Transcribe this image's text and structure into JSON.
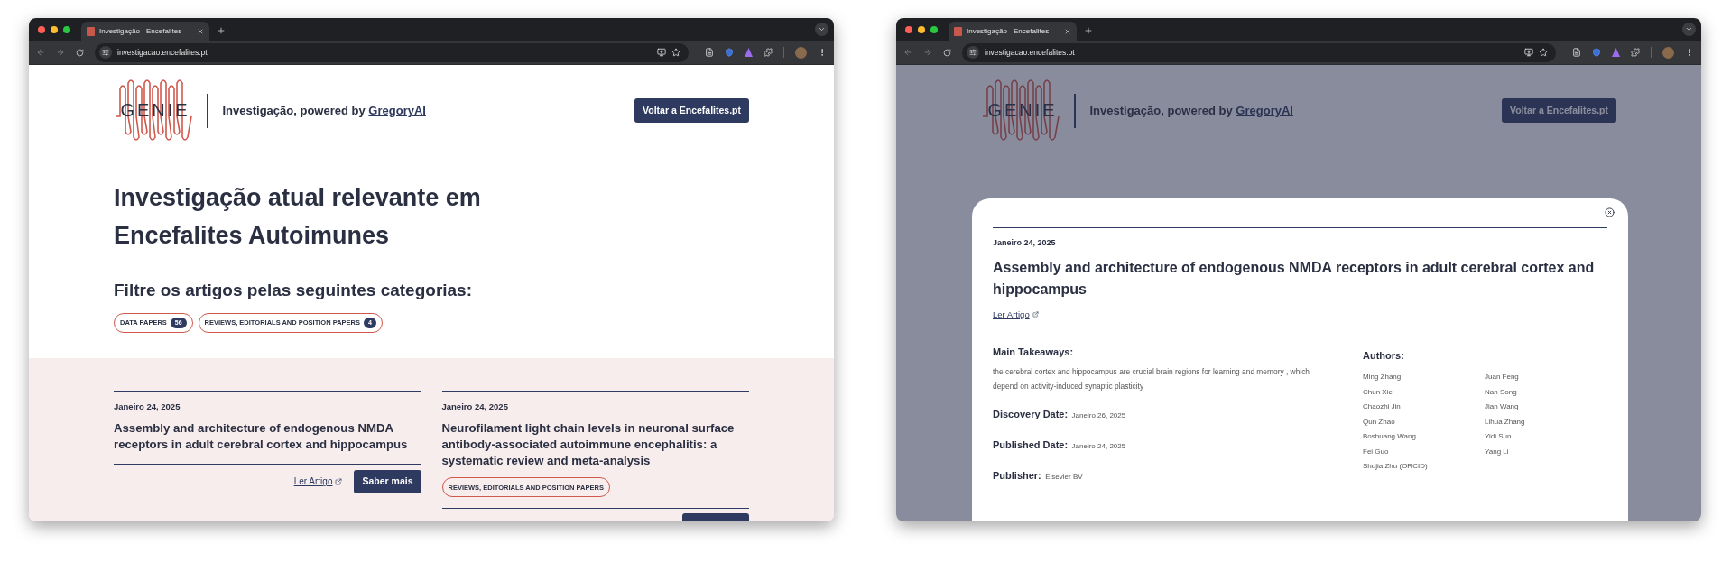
{
  "windows": [
    {
      "tab_title": "Investigação - Encefalites",
      "url": "investigacao.encefalites.pt",
      "dimmed": false,
      "header": {
        "logo_text": "GENIE",
        "tagline": "Investigação, powered by",
        "tagline_link": "GregoryAI",
        "back_button": "Voltar a Encefalites.pt"
      },
      "heading_lines": [
        "Investigação atual relevante em",
        "Encefalites Autoimunes"
      ],
      "filter_heading": "Filtre os artigos pelas seguintes categorias:",
      "categories": [
        {
          "label": "DATA PAPERS",
          "count": "56"
        },
        {
          "label": "REVIEWS, EDITORIALS AND POSITION PAPERS",
          "count": "4"
        }
      ],
      "articles": [
        {
          "kind": "actions",
          "date": "Janeiro 24, 2025",
          "title": "Assembly and architecture of endogenous NMDA receptors in adult cerebral cortex and hippocampus",
          "link": "Ler Artigo",
          "button": "Saber mais"
        },
        {
          "kind": "tagged",
          "date": "Janeiro 24, 2025",
          "title": "Neurofilament light chain levels in neuronal surface antibody-associated autoimmune encephalitis: a systematic review and meta-analysis",
          "tag": "REVIEWS, EDITORIALS AND POSITION PAPERS"
        }
      ]
    },
    {
      "tab_title": "Investigação - Encefalites",
      "url": "investigacao.encefalites.pt",
      "dimmed": true,
      "header": {
        "logo_text": "GENIE",
        "tagline": "Investigação, powered by",
        "tagline_link": "GregoryAI",
        "back_button": "Voltar a Encefalites.pt"
      },
      "modal": {
        "date": "Janeiro 24, 2025",
        "title": "Assembly and architecture of endogenous NMDA receptors in adult cerebral cortex and hippocampus",
        "link": "Ler Artigo",
        "takeaways_heading": "Main Takeaways:",
        "takeaways": "the cerebral cortex and hippocampus are crucial brain regions for learning and memory , which depend on activity-induced synaptic plasticity",
        "fields": [
          {
            "label": "Discovery Date:",
            "value": "Janeiro 26, 2025"
          },
          {
            "label": "Published Date:",
            "value": "Janeiro 24, 2025"
          },
          {
            "label": "Publisher:",
            "value": "Elsevier BV"
          }
        ],
        "authors_heading": "Authors:",
        "authors": [
          "Ming Zhang",
          "Chun Xie",
          "Chaozhi Jin",
          "Qun Zhao",
          "Boshuang Wang",
          "Fei Guo",
          "Shujia Zhu (ORCID)",
          "Juan Feng",
          "Nan Song",
          "Jian Wang",
          "Lihua Zhang",
          "Yidi Sun",
          "Yang Li"
        ]
      }
    }
  ]
}
